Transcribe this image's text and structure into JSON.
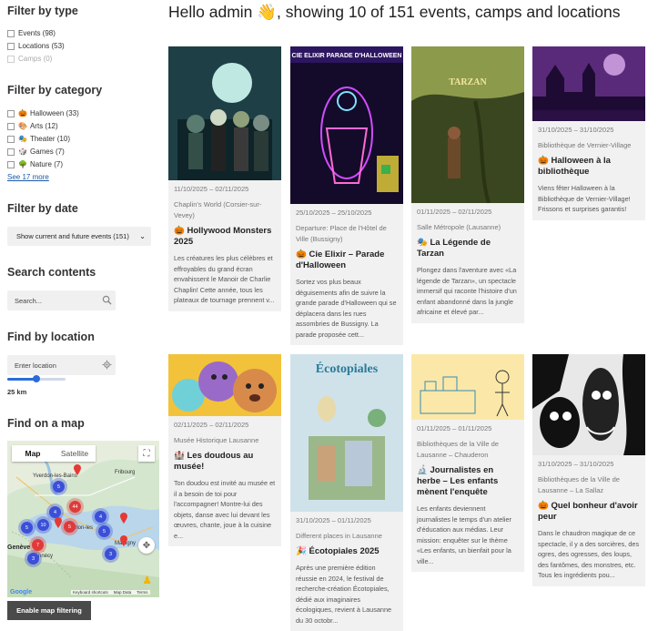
{
  "sidebar": {
    "type_title": "Filter by type",
    "types": [
      {
        "label": "Events (98)",
        "enabled": true
      },
      {
        "label": "Locations (53)",
        "enabled": true
      },
      {
        "label": "Camps (0)",
        "enabled": false
      }
    ],
    "category_title": "Filter by category",
    "categories": [
      {
        "emoji": "🎃",
        "label": "Halloween (33)"
      },
      {
        "emoji": "🎨",
        "label": "Arts (12)"
      },
      {
        "emoji": "🎭",
        "label": "Theater (10)"
      },
      {
        "emoji": "🎲",
        "label": "Games (7)"
      },
      {
        "emoji": "🌳",
        "label": "Nature (7)"
      }
    ],
    "see_more": "See 17 more",
    "date_title": "Filter by date",
    "date_select": "Show current and future events (151)",
    "search_title": "Search contents",
    "search_placeholder": "Search...",
    "location_title": "Find by location",
    "location_placeholder": "Enter location",
    "radius_fraction": 0.5,
    "radius_label": "25 km",
    "map_title": "Find on a map",
    "map_tab_map": "Map",
    "map_tab_satellite": "Satellite",
    "map_clusters": [
      "5",
      "10",
      "5",
      "4",
      "4",
      "5",
      "3",
      "3",
      "44",
      "7",
      "5"
    ],
    "map_labels": {
      "yverdon": "Yverdon-les-Bains",
      "fribourg": "Fribourg",
      "geneve": "Genève",
      "annecy": "Annecy",
      "martigny": "Martigny",
      "thonon": "Thonon-les",
      "google": "Google",
      "shortcuts": "Keyboard shortcuts",
      "mapdata": "Map Data",
      "terms": "Terms"
    },
    "enable_map": "Enable map filtering"
  },
  "header": {
    "title": "Hello admin 👋, showing 10 of 151 events, camps and locations"
  },
  "cards": [
    {
      "date": "11/10/2025 – 02/11/2025",
      "venue": "Chaplin's World (Corsier-sur-Vevey)",
      "emoji": "🎃",
      "title": "Hollywood Monsters 2025",
      "desc": "Les créatures les plus célèbres et effroyables du grand écran envahissent le Manoir de Charlie Chaplin! Cette année, tous les plateaux de tournage prennent v..."
    },
    {
      "date": "25/10/2025 – 25/10/2025",
      "venue": "Departure: Place de l'Hôtel de Ville (Bussigny)",
      "emoji": "🎃",
      "title": "Cie Elixir – Parade d'Halloween",
      "desc": "Sortez vos plus beaux déguisements afin de suivre la grande parade d'Halloween qui se déplacera dans les rues assombries de Bussigny. La parade proposée cett...",
      "poster_title": "CIE ELIXIR PARADE D'HALLOWEEN"
    },
    {
      "date": "01/11/2025 – 02/11/2025",
      "venue": "Salle Métropole (Lausanne)",
      "emoji": "🎭",
      "title": "La Légende de Tarzan",
      "desc": "Plongez dans l'aventure avec «La légende de Tarzan», un spectacle immersif qui raconte l'histoire d'un enfant abandonné dans la jungle africaine et élevé par...",
      "poster_title": "TARZAN"
    },
    {
      "date": "31/10/2025 – 31/10/2025",
      "venue": "Bibliothèque de Vernier-Village",
      "emoji": "🎃",
      "title": "Halloween à la bibliothèque",
      "desc": "Viens fêter Halloween à la Bibliothèque de Vernier-Village! Frissons et surprises garantis!"
    },
    {
      "date": "02/11/2025 – 02/11/2025",
      "venue": "Musée Historique Lausanne",
      "emoji": "🏰",
      "title": "Les doudous au musée!",
      "desc": "Ton doudou est invité au musée et il a besoin de toi pour l'accompagner! Montre-lui des objets, danse avec lui devant les œuvres, chante, joue à la cuisine e..."
    },
    {
      "date": "31/10/2025 – 01/11/2025",
      "venue": "Different places in Lausanne",
      "emoji": "🎉",
      "title": "Écotopiales 2025",
      "desc": "Après une première édition réussie en 2024, le festival de recherche-création Écotopiales, dédié aux imaginaires écologiques, revient à Lausanne du 30 octobr...",
      "poster_title": "Écotopiales"
    },
    {
      "date": "01/11/2025 – 01/11/2025",
      "venue": "Bibliothèques de la Ville de Lausanne – Chauderon",
      "emoji": "🔬",
      "title": "Journalistes en herbe – Les enfants mènent l'enquête",
      "desc": "Les enfants deviennent journalistes le temps d'un atelier d'éducation aux médias. Leur mission: enquêter sur le thème «Les enfants, un bienfait pour la ville..."
    },
    {
      "date": "31/10/2025 – 31/10/2025",
      "venue": "Bibliothèques de la Ville de Lausanne – La Sallaz",
      "emoji": "🎃",
      "title": "Quel bonheur d'avoir peur",
      "desc": "Dans le chaudron magique de ce spectacle, il y a des sorcières, des ogres, des ogresses, des loups, des fantômes, des monstres, etc. Tous les ingrédients pou..."
    }
  ]
}
